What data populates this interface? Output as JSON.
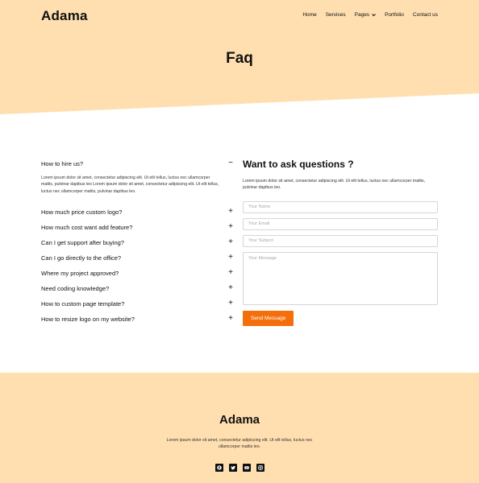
{
  "header": {
    "logo": "Adama",
    "nav": [
      {
        "label": "Home"
      },
      {
        "label": "Services"
      },
      {
        "label": "Pages"
      },
      {
        "label": "Portfolio"
      },
      {
        "label": "Contact us"
      }
    ],
    "title": "Faq"
  },
  "faq": {
    "open_question": "How to hire us?",
    "open_answer": "Lorem ipsum dolor sit amet, consectetur adipiscing elit. Ut elit tellus, luctus nec ullamcorper mattis, pulvinar dapibus leo Lorem ipsum dolor sit amet, consectetur adipiscing elit. Ut elit tellus, luctus nec ullamcorper mattis, pulvinar dapibus leo.",
    "items": [
      {
        "question": "How much price custom logo?"
      },
      {
        "question": "How much cost want add feature?"
      },
      {
        "question": "Can I get support after buying?"
      },
      {
        "question": "Can I go directly to the office?"
      },
      {
        "question": "Where my project approved?"
      },
      {
        "question": "Need coding knowledge?"
      },
      {
        "question": "How to custom page template?"
      },
      {
        "question": "How to resize logo on my website?"
      }
    ]
  },
  "contact": {
    "title": "Want to ask questions ?",
    "description": "Lorem ipsum dolor sit amet, consectetur adipiscing elit. Ut elit tellus, luctus nec ullamcorper mattis, pulvinar dapibus leo.",
    "name_placeholder": "Your Name",
    "email_placeholder": "Your Email",
    "subject_placeholder": "Your Subject",
    "message_placeholder": "Your Message",
    "button": "Send Message"
  },
  "footer": {
    "logo": "Adama",
    "text": "Lorem ipsum dolor sit amet, consectetur adipiscing elit. Ut elit tellus, luctus nec ullamcorper mattis leo.",
    "socials": [
      {
        "icon": "facebook-icon"
      },
      {
        "icon": "twitter-icon"
      },
      {
        "icon": "youtube-icon"
      },
      {
        "icon": "instagram-icon"
      }
    ]
  },
  "colors": {
    "peach": "#ffdfb0",
    "accent": "#f46f0c"
  }
}
